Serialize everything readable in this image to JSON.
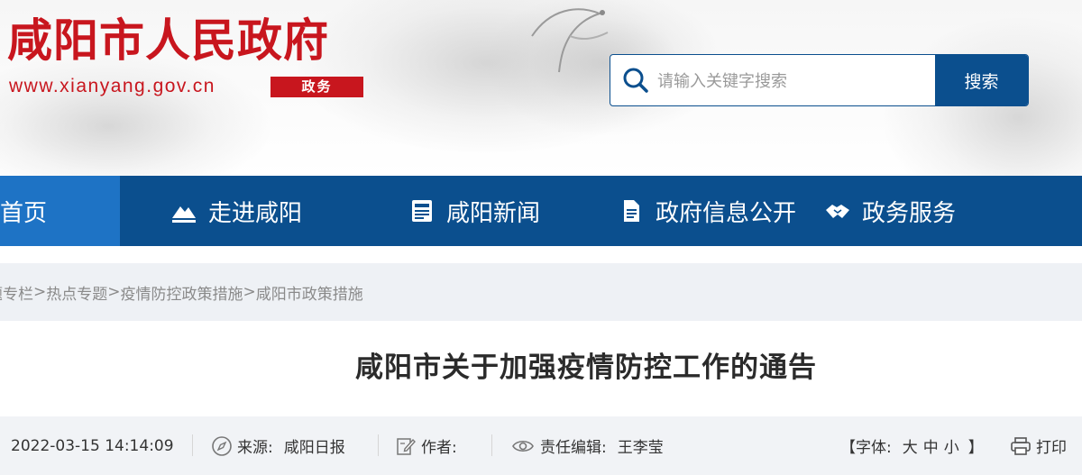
{
  "header": {
    "site_title": "咸阳市人民政府",
    "site_url": "www.xianyang.gov.cn",
    "site_badge": "政务",
    "brand_red": "#c8161e",
    "search": {
      "placeholder": "请输入关键字搜索",
      "value": "",
      "button_label": "搜索"
    }
  },
  "nav": {
    "accent": "#0b4f8e",
    "active_color": "#1e73c5",
    "items": [
      {
        "label": "首页",
        "icon": "none",
        "active": true
      },
      {
        "label": "走进咸阳",
        "icon": "mountain-icon"
      },
      {
        "label": "咸阳新闻",
        "icon": "newspaper-icon"
      },
      {
        "label": "政府信息公开",
        "icon": "document-icon"
      },
      {
        "label": "政务服务",
        "icon": "handshake-icon"
      }
    ]
  },
  "breadcrumb": {
    "items": [
      "题专栏",
      "热点专题",
      "疫情防控政策措施",
      "咸阳市政策措施"
    ],
    "separator": ">"
  },
  "article": {
    "title": "咸阳市关于加强疫情防控工作的通告",
    "meta": {
      "datetime": "2022-03-15 14:14:09",
      "source_label": "来源:",
      "source_value": "咸阳日报",
      "author_label": "作者:",
      "author_value": "",
      "editor_label": "责任编辑:",
      "editor_value": "王李莹",
      "font_label": "【字体:",
      "font_options": [
        "大",
        "中",
        "小"
      ],
      "font_close": "】",
      "print_label": "打印"
    }
  }
}
